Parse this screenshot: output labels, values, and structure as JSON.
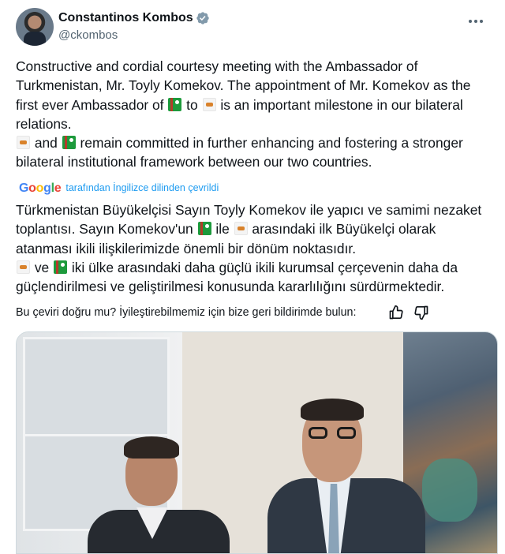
{
  "author": {
    "name": "Constantinos Kombos",
    "handle": "@ckombos",
    "verified_icon": "verified-badge-icon",
    "more_icon": "more-options-icon"
  },
  "original": {
    "p1a": "Constructive and cordial courtesy meeting with the Ambassador of Turkmenistan, Mr. Toyly Komekov. The appointment of Mr. Komekov as the first ever Ambassador of ",
    "p1b": " to ",
    "p1c": " is an important milestone in our bilateral relations.",
    "p2a": " and ",
    "p2b": " remain committed in further enhancing and fostering a stronger bilateral institutional framework between our two countries."
  },
  "translation": {
    "provider": "Google",
    "link_label": "tarafından İngilizce dilinden çevrildi"
  },
  "translated": {
    "p1a": "Türkmenistan Büyükelçisi Sayın Toyly Komekov ile yapıcı ve samimi nezaket toplantısı. Sayın Komekov'un ",
    "p1b": " ile ",
    "p1c": " arasındaki ilk Büyükelçi olarak atanması ikili ilişkilerimizde önemli bir dönüm noktasıdır.",
    "p2a": " ve ",
    "p2b": " iki ülke arasındaki daha güçlü ikili kurumsal çerçevenin daha da güçlendirilmesi ve geliştirilmesi konusunda kararlılığını sürdürmektedir."
  },
  "feedback": {
    "question": "Bu çeviri doğru mu? İyileştirebilmemiz için bize geri bildirimde bulun:",
    "like_icon": "thumbs-up-icon",
    "dislike_icon": "thumbs-down-icon"
  },
  "flags": {
    "turkmenistan": "turkmenistan-flag-icon",
    "cyprus": "cyprus-flag-icon"
  },
  "colors": {
    "link": "#1d9bf0",
    "text": "#0f1419",
    "muted": "#536471"
  }
}
